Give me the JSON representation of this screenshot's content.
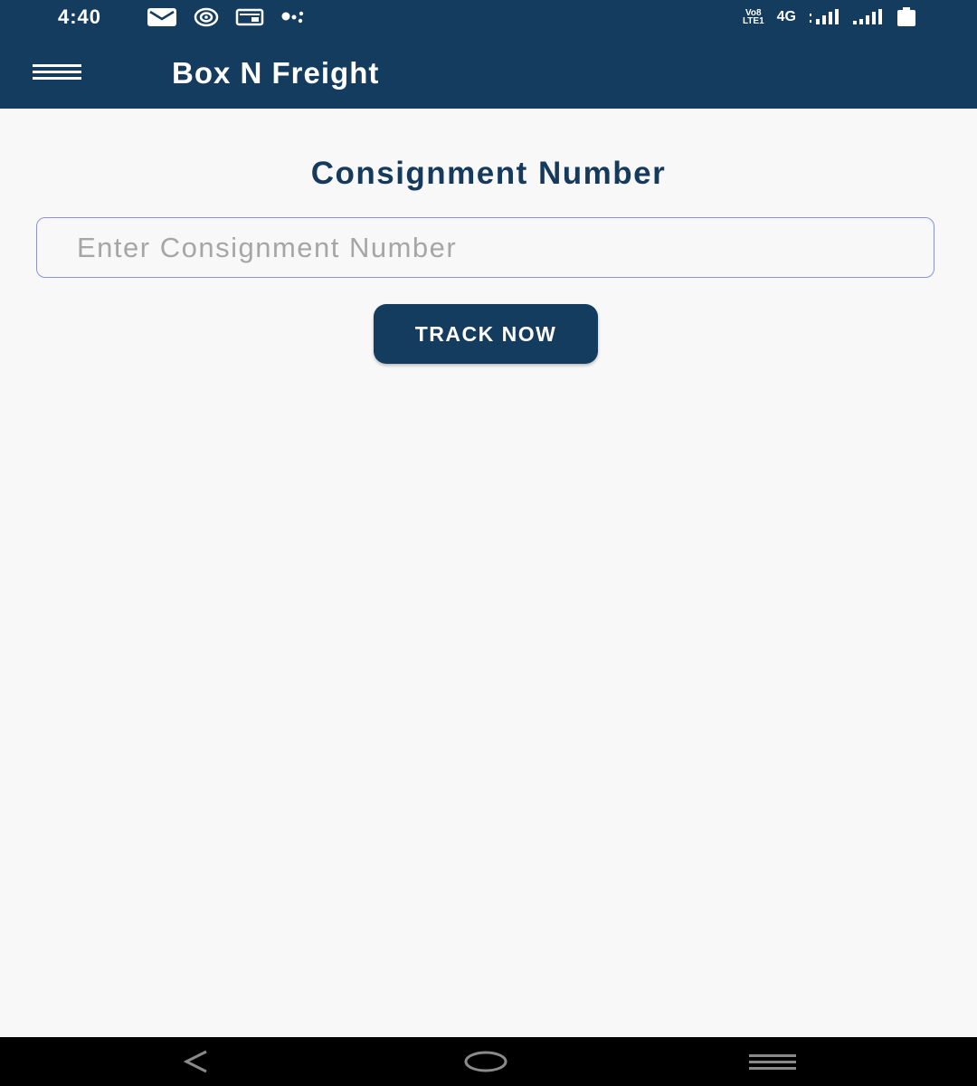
{
  "status_bar": {
    "time": "4:40",
    "network_label": "4G",
    "volte_label_top": "Vo8",
    "volte_label_bottom": "LTE1",
    "icons_left": [
      "mail-icon",
      "vpn-shield-icon",
      "cast-icon",
      "assistant-dots-icon"
    ],
    "icons_right": [
      "signal-strength-icon",
      "signal-strength-icon",
      "battery-icon"
    ]
  },
  "app_bar": {
    "title": "Box N Freight",
    "menu_icon": "hamburger-menu-icon",
    "background_color": "#143c5e"
  },
  "main": {
    "section_title": "Consignment Number",
    "input": {
      "value": "",
      "placeholder": "Enter Consignment Number"
    },
    "track_button_label": "TRACK NOW",
    "accent_color": "#143c5e"
  },
  "nav_bar": {
    "icons": [
      "back-icon",
      "home-icon",
      "recents-icon"
    ]
  }
}
